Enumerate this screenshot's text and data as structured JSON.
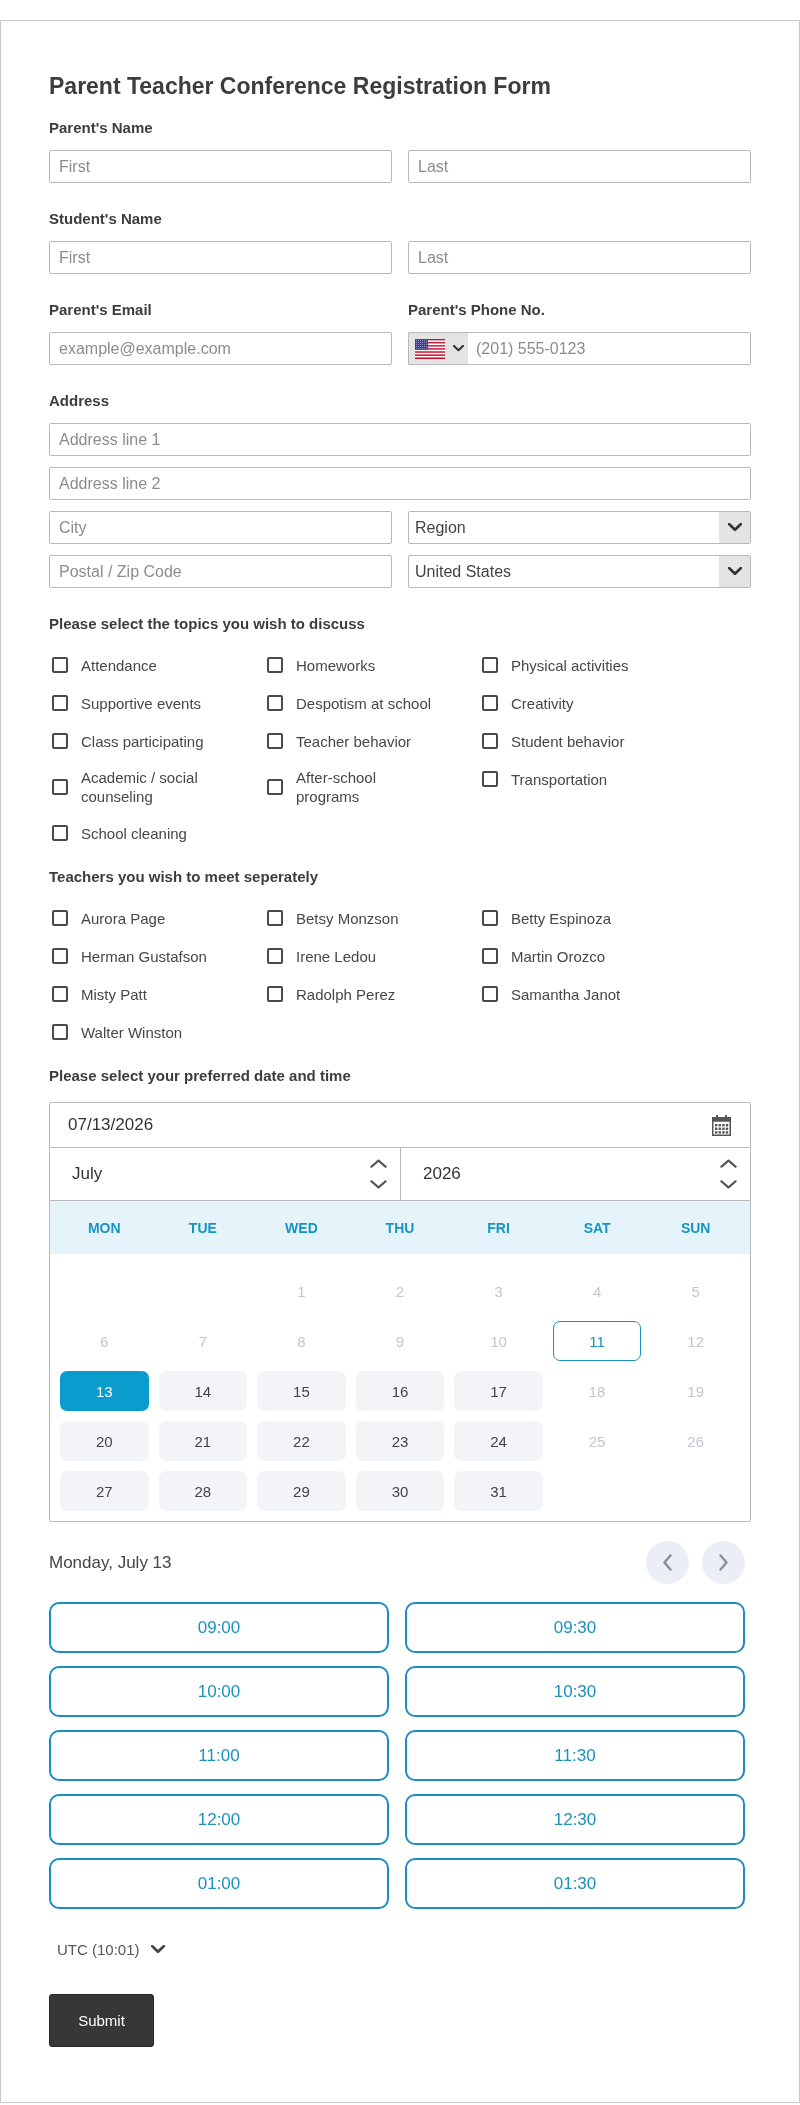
{
  "title": "Parent Teacher Conference Registration Form",
  "parent_name": {
    "label": "Parent's Name",
    "first": {
      "placeholder": "First"
    },
    "last": {
      "placeholder": "Last"
    }
  },
  "student_name": {
    "label": "Student's Name",
    "first": {
      "placeholder": "First"
    },
    "last": {
      "placeholder": "Last"
    }
  },
  "parent_email": {
    "label": "Parent's Email",
    "placeholder": "example@example.com"
  },
  "parent_phone": {
    "label": "Parent's Phone No.",
    "placeholder": "(201) 555-0123"
  },
  "address": {
    "label": "Address",
    "line_1": {
      "placeholder": "Address line 1"
    },
    "line_2": {
      "placeholder": "Address line 2"
    },
    "city": {
      "placeholder": "City"
    },
    "region": {
      "value": "Region"
    },
    "postal_code": {
      "placeholder": "Postal / Zip Code"
    },
    "country": {
      "value": "United States"
    }
  },
  "topics": {
    "label": "Please select the topics you wish to discuss",
    "options": [
      {
        "label": "Attendance",
        "checked": false
      },
      {
        "label": "Homeworks",
        "checked": false
      },
      {
        "label": "Physical activities",
        "checked": false
      },
      {
        "label": "Supportive events",
        "checked": false
      },
      {
        "label": "Despotism at school",
        "checked": false
      },
      {
        "label": "Creativity",
        "checked": false
      },
      {
        "label": "Class participating",
        "checked": false
      },
      {
        "label": "Teacher behavior",
        "checked": false
      },
      {
        "label": "Student behavior",
        "checked": false
      },
      {
        "label": "Academic / social counseling",
        "checked": false
      },
      {
        "label": "After-school programs",
        "checked": false
      },
      {
        "label": "Transportation",
        "checked": false
      },
      {
        "label": "School cleaning",
        "checked": false
      }
    ]
  },
  "teachers": {
    "label": "Teachers you wish to meet seperately",
    "options": [
      {
        "label": "Aurora Page",
        "checked": false
      },
      {
        "label": "Betsy Monzson",
        "checked": false
      },
      {
        "label": "Betty Espinoza",
        "checked": false
      },
      {
        "label": "Herman Gustafson",
        "checked": false
      },
      {
        "label": "Irene Ledou",
        "checked": false
      },
      {
        "label": "Martin Orozco",
        "checked": false
      },
      {
        "label": "Misty Patt",
        "checked": false
      },
      {
        "label": "Radolph Perez",
        "checked": false
      },
      {
        "label": "Samantha Janot",
        "checked": false
      },
      {
        "label": "Walter Winston",
        "checked": false
      }
    ]
  },
  "appointment": {
    "label": "Please select your preferred date and time",
    "date": {
      "value": "07/13/2026"
    },
    "month": {
      "value": "July"
    },
    "year": {
      "value": "2026"
    },
    "weekdays": [
      "MON",
      "TUE",
      "WED",
      "THU",
      "FRI",
      "SAT",
      "SUN"
    ],
    "weeks": [
      [
        {
          "label": "1",
          "disabled": true,
          "selected": false,
          "today": false
        },
        {
          "label": "2",
          "disabled": true,
          "selected": false,
          "today": false
        },
        {
          "label": "3",
          "disabled": true,
          "selected": false,
          "today": false
        },
        {
          "label": "4",
          "disabled": true,
          "selected": false,
          "today": false
        },
        {
          "label": "5",
          "disabled": true,
          "selected": false,
          "today": false
        }
      ],
      [
        {
          "label": "6",
          "disabled": true,
          "selected": false,
          "today": false
        },
        {
          "label": "7",
          "disabled": true,
          "selected": false,
          "today": false
        },
        {
          "label": "8",
          "disabled": true,
          "selected": false,
          "today": false
        },
        {
          "label": "9",
          "disabled": true,
          "selected": false,
          "today": false
        },
        {
          "label": "10",
          "disabled": true,
          "selected": false,
          "today": false
        },
        {
          "label": "11",
          "disabled": true,
          "selected": false,
          "today": true
        },
        {
          "label": "12",
          "disabled": true,
          "selected": false,
          "today": false
        }
      ],
      [
        {
          "label": "13",
          "disabled": false,
          "selected": true,
          "today": false
        },
        {
          "label": "14",
          "disabled": false,
          "selected": false,
          "today": false
        },
        {
          "label": "15",
          "disabled": false,
          "selected": false,
          "today": false
        },
        {
          "label": "16",
          "disabled": false,
          "selected": false,
          "today": false
        },
        {
          "label": "17",
          "disabled": false,
          "selected": false,
          "today": false
        },
        {
          "label": "18",
          "disabled": true,
          "selected": false,
          "today": false
        },
        {
          "label": "19",
          "disabled": true,
          "selected": false,
          "today": false
        }
      ],
      [
        {
          "label": "20",
          "disabled": false,
          "selected": false,
          "today": false
        },
        {
          "label": "21",
          "disabled": false,
          "selected": false,
          "today": false
        },
        {
          "label": "22",
          "disabled": false,
          "selected": false,
          "today": false
        },
        {
          "label": "23",
          "disabled": false,
          "selected": false,
          "today": false
        },
        {
          "label": "24",
          "disabled": false,
          "selected": false,
          "today": false
        },
        {
          "label": "25",
          "disabled": true,
          "selected": false,
          "today": false
        },
        {
          "label": "26",
          "disabled": true,
          "selected": false,
          "today": false
        }
      ],
      [
        {
          "label": "27",
          "disabled": false,
          "selected": false,
          "today": false
        },
        {
          "label": "28",
          "disabled": false,
          "selected": false,
          "today": false
        },
        {
          "label": "29",
          "disabled": false,
          "selected": false,
          "today": false
        },
        {
          "label": "30",
          "disabled": false,
          "selected": false,
          "today": false
        },
        {
          "label": "31",
          "disabled": false,
          "selected": false,
          "today": false
        }
      ]
    ],
    "selected_day_label": "Monday, July 13",
    "time_slots": [
      {
        "label": "09:00",
        "selected": false
      },
      {
        "label": "09:30",
        "selected": false
      },
      {
        "label": "10:00",
        "selected": false
      },
      {
        "label": "10:30",
        "selected": false
      },
      {
        "label": "11:00",
        "selected": false
      },
      {
        "label": "11:30",
        "selected": false
      },
      {
        "label": "12:00",
        "selected": false
      },
      {
        "label": "12:30",
        "selected": false
      },
      {
        "label": "01:00",
        "selected": false
      },
      {
        "label": "01:30",
        "selected": false
      }
    ],
    "timezone": {
      "label": "UTC (10:01)"
    }
  },
  "submit": {
    "label": "Submit"
  }
}
